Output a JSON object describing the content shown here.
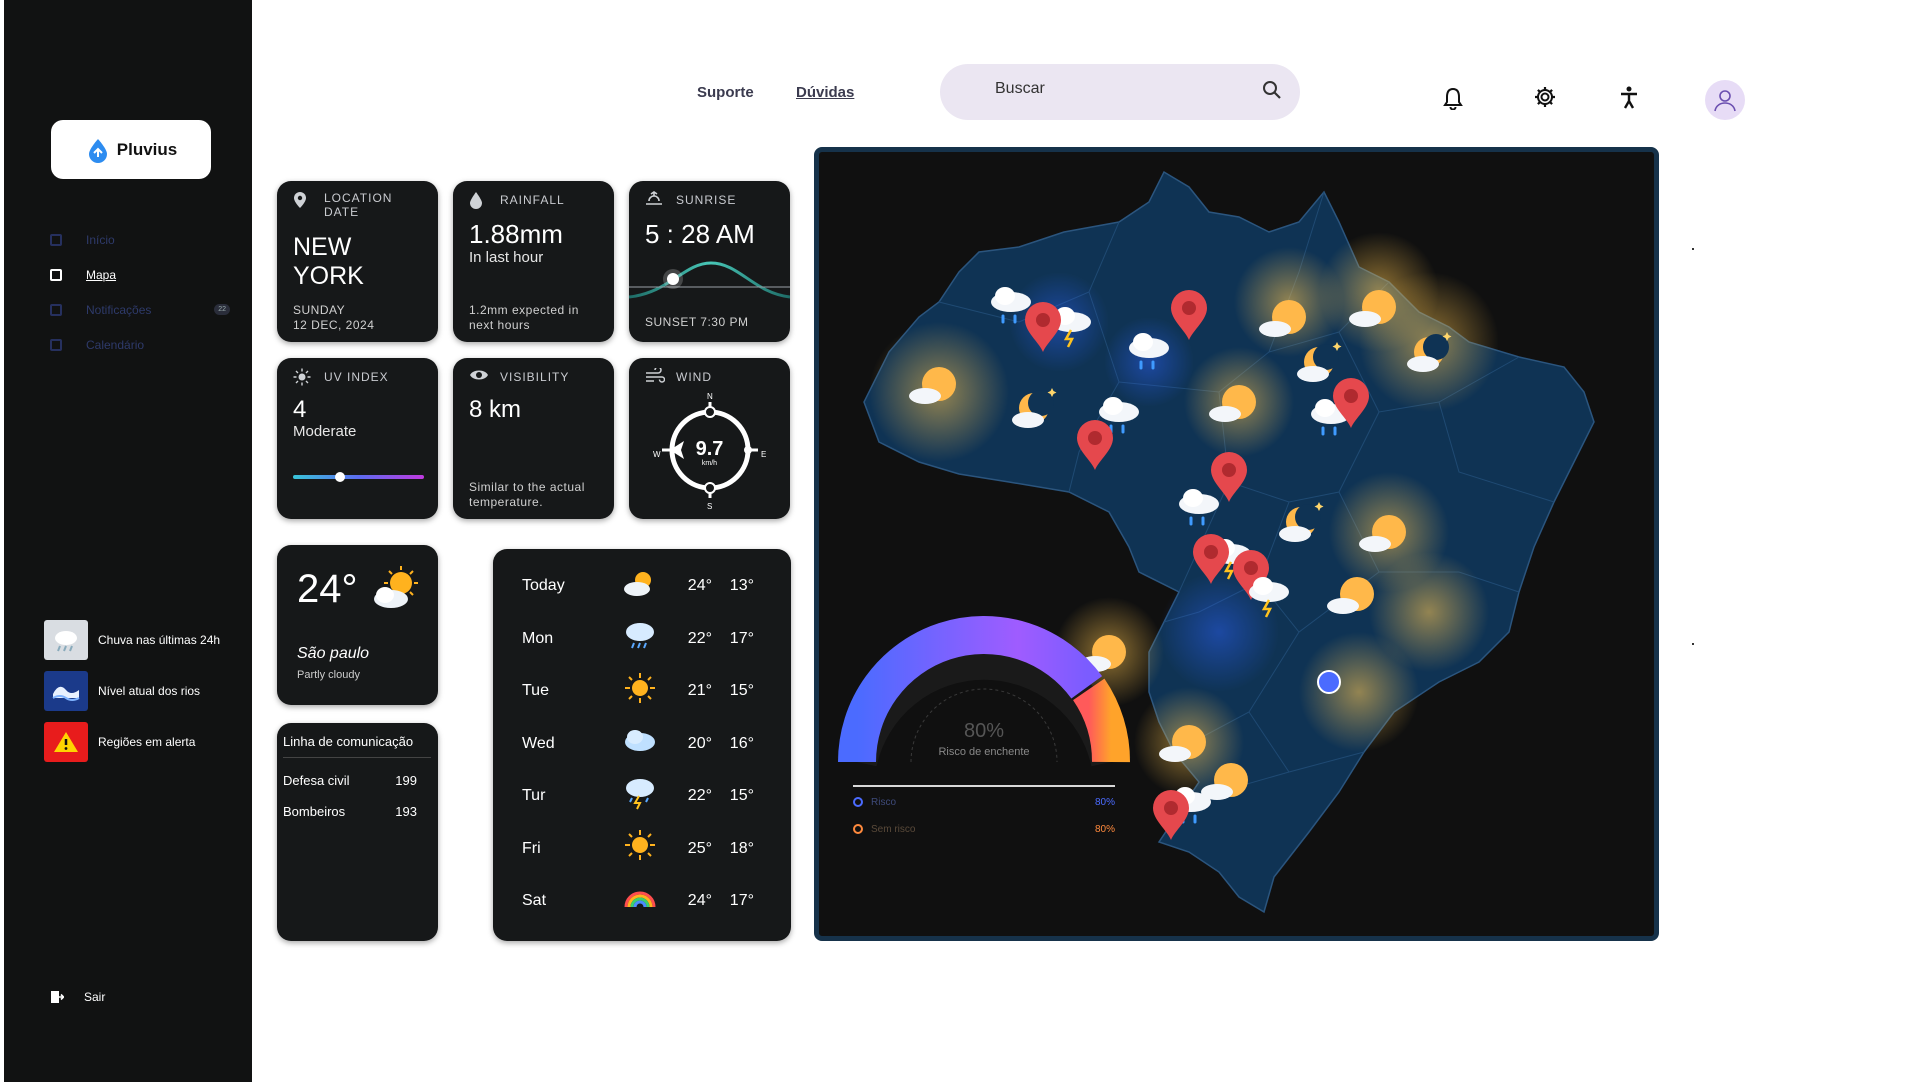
{
  "app": {
    "name": "Pluvius"
  },
  "sidebar": {
    "items": [
      {
        "label": "Início",
        "icon": "grid-icon"
      },
      {
        "label": "Mapa",
        "icon": "map-icon"
      },
      {
        "label": "Notificações",
        "icon": "chat-icon",
        "badge": "22"
      },
      {
        "label": "Calendário",
        "icon": "calendar-icon"
      }
    ],
    "quick": [
      {
        "label": "Chuva nas últimas 24h",
        "icon": "rain-cloud-icon"
      },
      {
        "label": "Nível atual dos rios",
        "icon": "wave-icon"
      },
      {
        "label": "Regiões em alerta",
        "icon": "warning-icon"
      }
    ],
    "logout": "Sair"
  },
  "header": {
    "links": [
      "Suporte",
      "Dúvidas"
    ],
    "search_placeholder": "Buscar"
  },
  "cards": {
    "location": {
      "label_line1": "LOCATION",
      "label_line2": "DATE",
      "city_line1": "NEW",
      "city_line2": "YORK",
      "day": "SUNDAY",
      "date": "12 DEC, 2024"
    },
    "rainfall": {
      "label": "RAINFALL",
      "value": "1.88mm",
      "sub": "In last hour",
      "note_line1": "1.2mm expected in",
      "note_line2": "next hours"
    },
    "sunrise": {
      "label": "SUNRISE",
      "value": "5 : 28 AM",
      "sunset": "SUNSET 7:30 PM"
    },
    "uv": {
      "label": "UV INDEX",
      "value": "4",
      "level": "Moderate",
      "fraction": 0.36
    },
    "visibility": {
      "label": "VISIBILITY",
      "value": "8 km",
      "note_line1": "Similar to the actual",
      "note_line2": "temperature."
    },
    "wind": {
      "label": "WIND",
      "speed": "9.7",
      "unit": "km/h",
      "n": "N",
      "s": "S",
      "e": "E",
      "w": "W"
    },
    "current": {
      "temp": "24°",
      "city": "São paulo",
      "condition": "Partly cloudy"
    },
    "contacts": {
      "title": "Linha de comunicação",
      "rows": [
        {
          "name": "Defesa civil",
          "number": "199"
        },
        {
          "name": "Bombeiros",
          "number": "193"
        }
      ]
    }
  },
  "forecast": [
    {
      "day": "Today",
      "icon": "partly-cloudy-icon",
      "hi": "24°",
      "lo": "13°"
    },
    {
      "day": "Mon",
      "icon": "rain-icon",
      "hi": "22°",
      "lo": "17°"
    },
    {
      "day": "Tue",
      "icon": "sun-icon",
      "hi": "21°",
      "lo": "15°"
    },
    {
      "day": "Wed",
      "icon": "cloud-icon",
      "hi": "20°",
      "lo": "16°"
    },
    {
      "day": "Tur",
      "icon": "storm-icon",
      "hi": "22°",
      "lo": "15°"
    },
    {
      "day": "Fri",
      "icon": "sun-icon",
      "hi": "25°",
      "lo": "18°"
    },
    {
      "day": "Sat",
      "icon": "rainbow-icon",
      "hi": "24°",
      "lo": "17°"
    }
  ],
  "map": {
    "gauge": {
      "percent": "80%",
      "label": "Risco de enchente",
      "value": 0.8
    },
    "legend": [
      {
        "label": "Risco",
        "value": "80%",
        "color": "#4b6bff"
      },
      {
        "label": "Sem risco",
        "value": "80%",
        "color": "#ff8a3d"
      }
    ]
  },
  "colors": {
    "sidebar": "#111212",
    "card": "#161819",
    "map_land": "#0f3354",
    "pin": "#e5484d",
    "accent": "#7b5cff"
  }
}
